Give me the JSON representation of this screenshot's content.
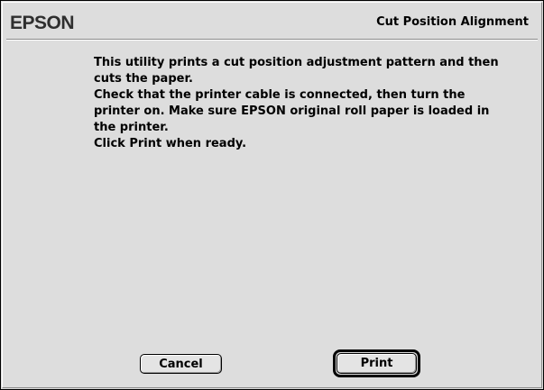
{
  "header": {
    "brand": "EPSON",
    "title": "Cut Position Alignment"
  },
  "message": {
    "lines": [
      "This utility prints a cut position adjustment pattern and then",
      "cuts the paper.",
      "Check that the printer cable is connected, then turn the",
      "printer on. Make sure EPSON original roll paper is loaded in",
      "the printer.",
      "Click Print when ready."
    ]
  },
  "buttons": {
    "cancel_label": "Cancel",
    "print_label": "Print"
  }
}
